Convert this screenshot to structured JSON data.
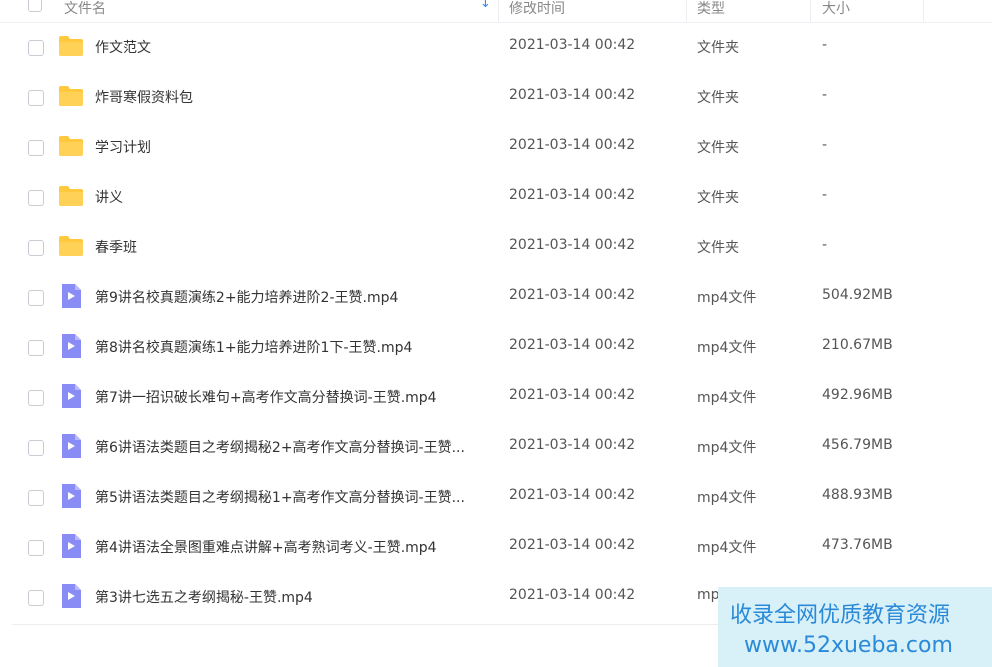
{
  "header": {
    "name": "文件名",
    "time": "修改时间",
    "type": "类型",
    "size": "大小"
  },
  "files": [
    {
      "name": "作文范文",
      "time": "2021-03-14 00:42",
      "type": "文件夹",
      "size": "-",
      "icon": "folder-icon"
    },
    {
      "name": "炸哥寒假资料包",
      "time": "2021-03-14 00:42",
      "type": "文件夹",
      "size": "-",
      "icon": "folder-icon"
    },
    {
      "name": "学习计划",
      "time": "2021-03-14 00:42",
      "type": "文件夹",
      "size": "-",
      "icon": "folder-icon"
    },
    {
      "name": "讲义",
      "time": "2021-03-14 00:42",
      "type": "文件夹",
      "size": "-",
      "icon": "folder-icon"
    },
    {
      "name": "春季班",
      "time": "2021-03-14 00:42",
      "type": "文件夹",
      "size": "-",
      "icon": "folder-icon"
    },
    {
      "name": "第9讲名校真题演练2+能力培养进阶2-王赞.mp4",
      "time": "2021-03-14 00:42",
      "type": "mp4文件",
      "size": "504.92MB",
      "icon": "video-file-icon"
    },
    {
      "name": "第8讲名校真题演练1+能力培养进阶1下-王赞.mp4",
      "time": "2021-03-14 00:42",
      "type": "mp4文件",
      "size": "210.67MB",
      "icon": "video-file-icon"
    },
    {
      "name": "第7讲一招识破长难句+高考作文高分替换词-王赞.mp4",
      "time": "2021-03-14 00:42",
      "type": "mp4文件",
      "size": "492.96MB",
      "icon": "video-file-icon"
    },
    {
      "name": "第6讲语法类题目之考纲揭秘2+高考作文高分替换词-王赞...",
      "time": "2021-03-14 00:42",
      "type": "mp4文件",
      "size": "456.79MB",
      "icon": "video-file-icon"
    },
    {
      "name": "第5讲语法类题目之考纲揭秘1+高考作文高分替换词-王赞...",
      "time": "2021-03-14 00:42",
      "type": "mp4文件",
      "size": "488.93MB",
      "icon": "video-file-icon"
    },
    {
      "name": "第4讲语法全景图重难点讲解+高考熟词考义-王赞.mp4",
      "time": "2021-03-14 00:42",
      "type": "mp4文件",
      "size": "473.76MB",
      "icon": "video-file-icon"
    },
    {
      "name": "第3讲七选五之考纲揭秘-王赞.mp4",
      "time": "2021-03-14 00:42",
      "type": "mp",
      "size": "",
      "icon": "video-file-icon"
    }
  ],
  "watermark": {
    "line1": "收录全网优质教育资源",
    "line2": "www.52xueba.com"
  },
  "colors": {
    "folder": "#ffc83d",
    "video": "#8a8cf5",
    "sort_accent": "#2f8cf7",
    "watermark_text": "#2a8ad8",
    "watermark_bg": "#d8f0f8"
  }
}
